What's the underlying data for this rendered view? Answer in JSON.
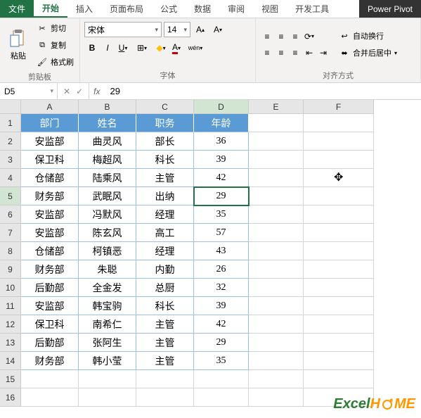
{
  "tabs": {
    "file": "文件",
    "home": "开始",
    "insert": "插入",
    "layout": "页面布局",
    "formula": "公式",
    "data": "数据",
    "review": "审阅",
    "view": "视图",
    "dev": "开发工具",
    "pivot": "Power Pivot"
  },
  "ribbon": {
    "clipboard": {
      "paste": "粘贴",
      "cut": "剪切",
      "copy": "复制",
      "format_painter": "格式刷",
      "label": "剪贴板"
    },
    "font": {
      "name": "宋体",
      "size": "14",
      "label": "字体"
    },
    "align": {
      "wrap": "自动换行",
      "merge": "合并后居中",
      "label": "对齐方式"
    }
  },
  "namebox": "D5",
  "formula": "29",
  "columns": [
    "A",
    "B",
    "C",
    "D",
    "E",
    "F"
  ],
  "header_row": [
    "部门",
    "姓名",
    "职务",
    "年龄"
  ],
  "chart_data": {
    "type": "table",
    "columns": [
      "部门",
      "姓名",
      "职务",
      "年龄"
    ],
    "rows": [
      [
        "安监部",
        "曲灵风",
        "部长",
        "36"
      ],
      [
        "保卫科",
        "梅超风",
        "科长",
        "39"
      ],
      [
        "仓储部",
        "陆乘风",
        "主管",
        "42"
      ],
      [
        "财务部",
        "武眠风",
        "出纳",
        "29"
      ],
      [
        "安监部",
        "冯默风",
        "经理",
        "35"
      ],
      [
        "安监部",
        "陈玄风",
        "高工",
        "57"
      ],
      [
        "仓储部",
        "柯镇恶",
        "经理",
        "43"
      ],
      [
        "财务部",
        "朱聪",
        "内勤",
        "26"
      ],
      [
        "后勤部",
        "全金发",
        "总厨",
        "32"
      ],
      [
        "安监部",
        "韩宝驹",
        "科长",
        "39"
      ],
      [
        "保卫科",
        "南希仁",
        "主管",
        "42"
      ],
      [
        "后勤部",
        "张阿生",
        "主管",
        "29"
      ],
      [
        "财务部",
        "韩小莹",
        "主管",
        "35"
      ]
    ]
  },
  "active_cell": {
    "row": 5,
    "col": 3
  },
  "logo": {
    "part1": "Excel",
    "part2": "H",
    "part3": "ME"
  }
}
